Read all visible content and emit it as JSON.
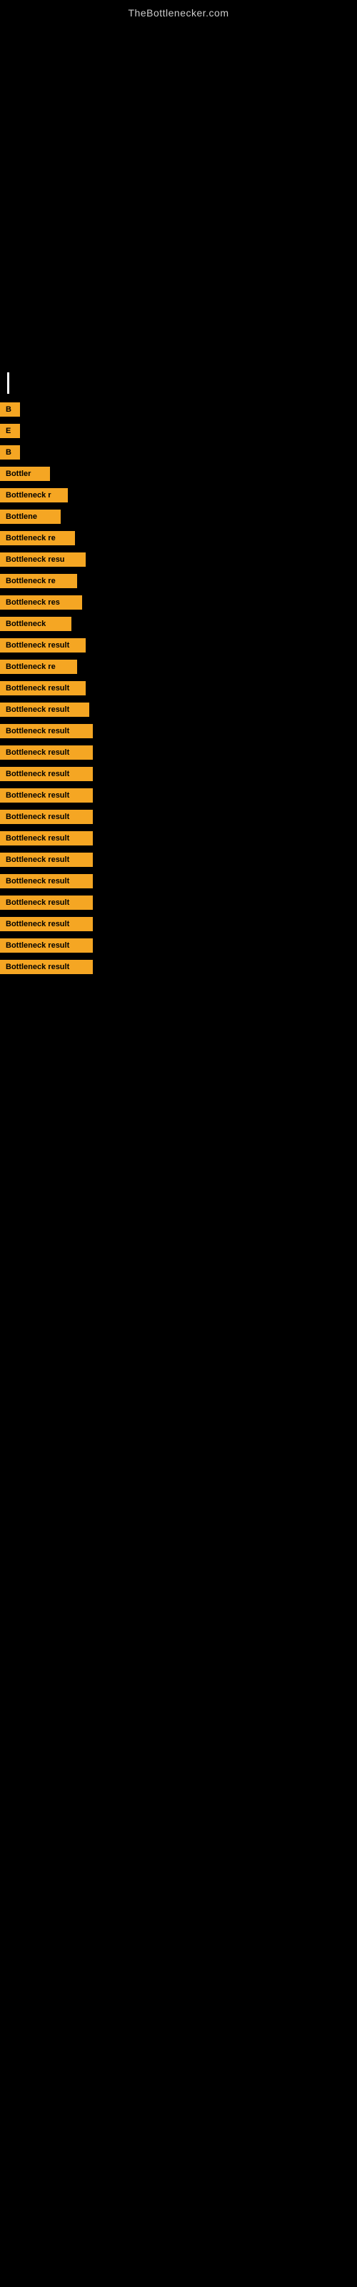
{
  "site": {
    "title": "TheBottlenecker.com"
  },
  "results": [
    {
      "id": 1,
      "label": "B"
    },
    {
      "id": 2,
      "label": "E"
    },
    {
      "id": 3,
      "label": "B"
    },
    {
      "id": 4,
      "label": "Bottler"
    },
    {
      "id": 5,
      "label": "Bottleneck r"
    },
    {
      "id": 6,
      "label": "Bottlene"
    },
    {
      "id": 7,
      "label": "Bottleneck re"
    },
    {
      "id": 8,
      "label": "Bottleneck resu"
    },
    {
      "id": 9,
      "label": "Bottleneck re"
    },
    {
      "id": 10,
      "label": "Bottleneck res"
    },
    {
      "id": 11,
      "label": "Bottleneck"
    },
    {
      "id": 12,
      "label": "Bottleneck result"
    },
    {
      "id": 13,
      "label": "Bottleneck re"
    },
    {
      "id": 14,
      "label": "Bottleneck result"
    },
    {
      "id": 15,
      "label": "Bottleneck result"
    },
    {
      "id": 16,
      "label": "Bottleneck result"
    },
    {
      "id": 17,
      "label": "Bottleneck result"
    },
    {
      "id": 18,
      "label": "Bottleneck result"
    },
    {
      "id": 19,
      "label": "Bottleneck result"
    },
    {
      "id": 20,
      "label": "Bottleneck result"
    },
    {
      "id": 21,
      "label": "Bottleneck result"
    },
    {
      "id": 22,
      "label": "Bottleneck result"
    },
    {
      "id": 23,
      "label": "Bottleneck result"
    },
    {
      "id": 24,
      "label": "Bottleneck result"
    },
    {
      "id": 25,
      "label": "Bottleneck result"
    },
    {
      "id": 26,
      "label": "Bottleneck result"
    },
    {
      "id": 27,
      "label": "Bottleneck result"
    }
  ]
}
